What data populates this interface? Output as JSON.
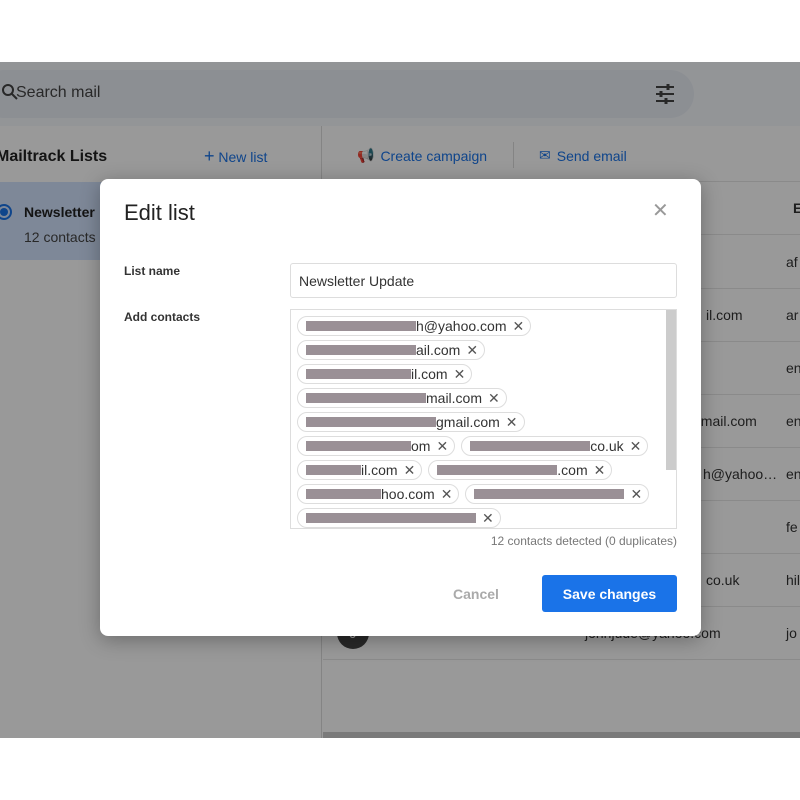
{
  "search": {
    "placeholder": "Search mail"
  },
  "sidebar": {
    "title": "Mailtrack Lists",
    "new_list": "New list",
    "lists": [
      {
        "name": "Newsletter",
        "count": "12 contacts"
      }
    ]
  },
  "actions": {
    "create_campaign": "Create campaign",
    "send_email": "Send email"
  },
  "table": {
    "header_col": "E",
    "rows": [
      {
        "email": "",
        "col": "af"
      },
      {
        "email": "il.com",
        "col": "ar"
      },
      {
        "email": "",
        "col": "en"
      },
      {
        "email": "gmail.com",
        "col": "en"
      },
      {
        "email": "h@yahoo…",
        "col": "en"
      },
      {
        "email": "",
        "col": "fe"
      },
      {
        "email": "co.uk",
        "col": "hil"
      },
      {
        "email": "johnjude@yahoo.com",
        "col": "jo",
        "avatar": "J"
      }
    ]
  },
  "dialog": {
    "title": "Edit list",
    "list_name_label": "List name",
    "list_name_value": "Newsletter Update",
    "add_contacts_label": "Add contacts",
    "contacts": [
      {
        "visible": "h@yahoo.com"
      },
      {
        "visible": "ail.com"
      },
      {
        "visible": "il.com"
      },
      {
        "visible": "mail.com"
      },
      {
        "visible": "gmail.com"
      },
      {
        "visible": "om"
      },
      {
        "visible": "co.uk"
      },
      {
        "visible": "il.com"
      },
      {
        "visible": ".com"
      },
      {
        "visible": "hoo.com"
      },
      {
        "visible": ""
      },
      {
        "visible": ""
      }
    ],
    "detected": "12 contacts detected (0 duplicates)",
    "cancel": "Cancel",
    "save": "Save changes"
  },
  "colors": {
    "accent": "#1a73e8",
    "selected_list": "#d3e3fd"
  }
}
